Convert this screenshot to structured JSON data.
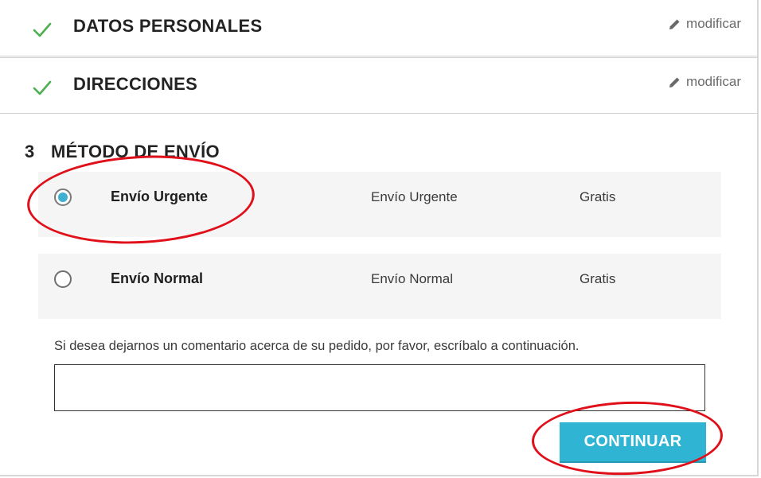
{
  "steps": [
    {
      "title": "DATOS PERSONALES",
      "modify_label": "modificar",
      "status_icon": "check-icon"
    },
    {
      "title": "DIRECCIONES",
      "modify_label": "modificar",
      "status_icon": "check-icon"
    }
  ],
  "shipping_section": {
    "number": "3",
    "title": "MÉTODO DE ENVÍO",
    "options": [
      {
        "name": "Envío Urgente",
        "description": "Envío Urgente",
        "price": "Gratis",
        "selected": true
      },
      {
        "name": "Envío Normal",
        "description": "Envío Normal",
        "price": "Gratis",
        "selected": false
      }
    ]
  },
  "comment": {
    "label": "Si desea dejarnos un comentario acerca de su pedido, por favor, escríbalo a continuación.",
    "value": ""
  },
  "continue_label": "CONTINUAR",
  "colors": {
    "accent": "#2fb5d3",
    "check": "#4caf50",
    "annotation": "#e0101a"
  }
}
